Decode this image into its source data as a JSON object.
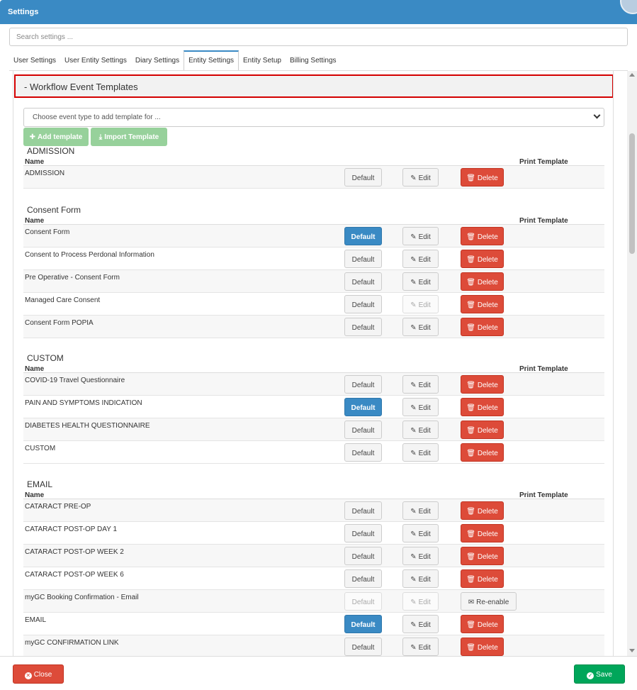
{
  "window": {
    "title": "Settings"
  },
  "search": {
    "placeholder": "Search settings ..."
  },
  "tabs": [
    {
      "label": "User Settings"
    },
    {
      "label": "User Entity Settings"
    },
    {
      "label": "Diary Settings"
    },
    {
      "label": "Entity Settings",
      "active": true
    },
    {
      "label": "Entity Setup"
    },
    {
      "label": "Billing Settings"
    }
  ],
  "section": {
    "title": "- Workflow Event Templates"
  },
  "event_type": {
    "placeholder": "Choose event type to add template for ..."
  },
  "actions": {
    "add_template": "Add template",
    "import_template": "Import Template"
  },
  "columns": {
    "name": "Name",
    "print_template": "Print Template"
  },
  "button_labels": {
    "default": "Default",
    "edit": "Edit",
    "delete": "Delete",
    "reenable": "Re-enable"
  },
  "groups": [
    {
      "title": "ADMISSION",
      "rows": [
        {
          "name": "ADMISSION",
          "default": "normal",
          "edit": "normal",
          "action": "delete"
        }
      ]
    },
    {
      "title": "Consent Form",
      "rows": [
        {
          "name": "Consent Form",
          "default": "primary",
          "edit": "normal",
          "action": "delete"
        },
        {
          "name": "Consent to Process Perdonal Information",
          "default": "normal",
          "edit": "normal",
          "action": "delete"
        },
        {
          "name": "Pre Operative - Consent Form",
          "default": "normal",
          "edit": "normal",
          "action": "delete"
        },
        {
          "name": "Managed Care Consent",
          "default": "normal",
          "edit": "disabled",
          "action": "delete"
        },
        {
          "name": "Consent Form POPIA",
          "default": "normal",
          "edit": "normal",
          "action": "delete"
        }
      ]
    },
    {
      "title": "CUSTOM",
      "rows": [
        {
          "name": "COVID-19 Travel Questionnaire",
          "default": "normal",
          "edit": "normal",
          "action": "delete"
        },
        {
          "name": "PAIN AND SYMPTOMS INDICATION",
          "default": "primary",
          "edit": "normal",
          "action": "delete"
        },
        {
          "name": "DIABETES HEALTH QUESTIONNAIRE",
          "default": "normal",
          "edit": "normal",
          "action": "delete"
        },
        {
          "name": "CUSTOM",
          "default": "normal",
          "edit": "normal",
          "action": "delete"
        }
      ]
    },
    {
      "title": "EMAIL",
      "rows": [
        {
          "name": "CATARACT PRE-OP",
          "default": "normal",
          "edit": "normal",
          "action": "delete"
        },
        {
          "name": "CATARACT POST-OP DAY 1",
          "default": "normal",
          "edit": "normal",
          "action": "delete"
        },
        {
          "name": "CATARACT POST-OP WEEK 2",
          "default": "normal",
          "edit": "normal",
          "action": "delete"
        },
        {
          "name": "CATARACT POST-OP WEEK 6",
          "default": "normal",
          "edit": "normal",
          "action": "delete"
        },
        {
          "name": "myGC Booking Confirmation - Email",
          "default": "disabled",
          "edit": "disabled",
          "action": "reenable"
        },
        {
          "name": "EMAIL",
          "default": "primary",
          "edit": "normal",
          "action": "delete"
        },
        {
          "name": "myGC CONFIRMATION LINK",
          "default": "normal",
          "edit": "normal",
          "action": "delete"
        }
      ]
    }
  ],
  "footer": {
    "close": "Close",
    "save": "Save"
  },
  "colors": {
    "header": "#3a8ac4",
    "primary": "#3a8ac4",
    "danger": "#dd4b39",
    "success": "#00a65a",
    "highlight_border": "#d40000"
  }
}
